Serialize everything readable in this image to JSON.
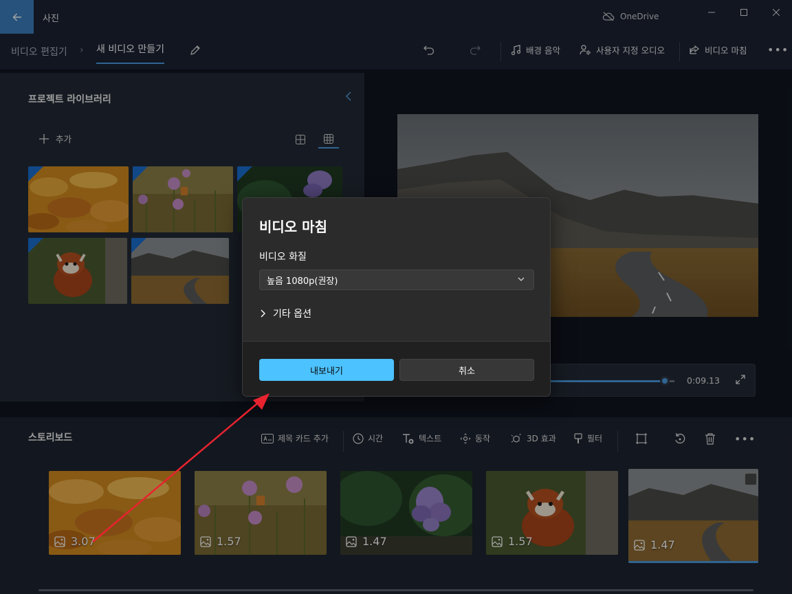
{
  "titlebar": {
    "app_title": "사진",
    "cloud_label": "OneDrive"
  },
  "toolbar": {
    "crumb_parent": "비디오 편집기",
    "crumb_separator": "›",
    "crumb_current": "새 비디오 만들기",
    "background_music": "배경 음악",
    "custom_audio": "사용자 지정 오디오",
    "finish_video": "비디오 마침"
  },
  "library": {
    "title": "프로젝트 라이브러리",
    "add_label": "추가"
  },
  "player": {
    "time": "0:09.13",
    "progress": 0.92
  },
  "storyboard": {
    "title": "스토리보드",
    "tools": {
      "title_card": "제목 카드 추가",
      "duration": "시간",
      "text": "텍스트",
      "motion": "동작",
      "effects_3d": "3D 효과",
      "filters": "필터"
    },
    "clips": [
      {
        "duration": "3.07"
      },
      {
        "duration": "1.57"
      },
      {
        "duration": "1.47"
      },
      {
        "duration": "1.57"
      },
      {
        "duration": "1.47"
      }
    ]
  },
  "dialog": {
    "title": "비디오 마침",
    "quality_label": "비디오 화질",
    "quality_value": "높음 1080p(권장)",
    "more_options": "기타 옵션",
    "export_button": "내보내기",
    "cancel_button": "취소"
  },
  "colors": {
    "accent": "#4cc2ff",
    "annotation_arrow": "#e8232f"
  }
}
